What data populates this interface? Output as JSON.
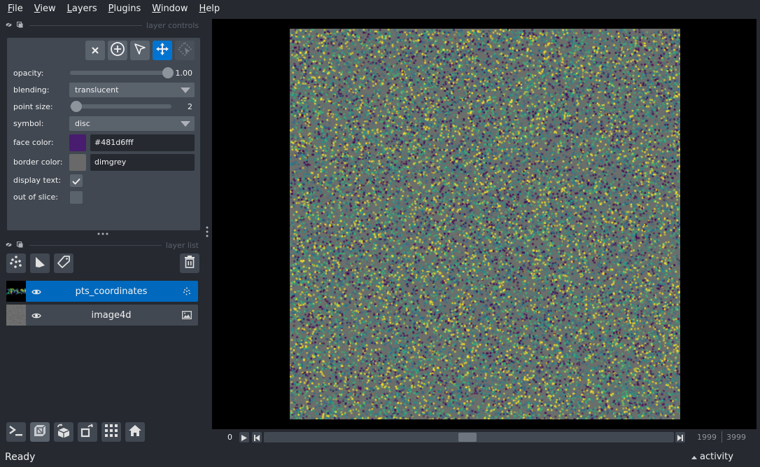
{
  "menu": [
    {
      "label": "File",
      "mnemonic": "F",
      "rest": "ile"
    },
    {
      "label": "View",
      "mnemonic": "V",
      "rest": "iew"
    },
    {
      "label": "Layers",
      "mnemonic": "L",
      "rest": "ayers"
    },
    {
      "label": "Plugins",
      "mnemonic": "P",
      "rest": "lugins"
    },
    {
      "label": "Window",
      "mnemonic": "W",
      "rest": "indow"
    },
    {
      "label": "Help",
      "mnemonic": "H",
      "rest": "elp"
    }
  ],
  "layer_controls": {
    "title": "layer controls",
    "tools": [
      {
        "name": "delete-selected-points",
        "icon": "close-icon",
        "state": "normal"
      },
      {
        "name": "add-points",
        "icon": "plus-circle-icon",
        "state": "normal"
      },
      {
        "name": "select-points",
        "icon": "pointer-icon",
        "state": "normal"
      },
      {
        "name": "pan-zoom",
        "icon": "move-arrows-icon",
        "state": "active"
      },
      {
        "name": "transform",
        "icon": "transform-icon",
        "state": "disabled"
      }
    ],
    "opacity": {
      "label": "opacity:",
      "value": 1.0,
      "display": "1.00"
    },
    "blending": {
      "label": "blending:",
      "value": "translucent"
    },
    "point_size": {
      "label": "point size:",
      "value": 2,
      "display": "2",
      "min": 1,
      "max": 100
    },
    "symbol": {
      "label": "symbol:",
      "value": "disc"
    },
    "face_color": {
      "label": "face color:",
      "value": "#481d6fff",
      "swatch": "#481d6f"
    },
    "border_color": {
      "label": "border color:",
      "value": "dimgrey",
      "swatch": "#696969"
    },
    "display_text": {
      "label": "display text:",
      "checked": true
    },
    "out_of_slice": {
      "label": "out of slice:",
      "checked": false
    }
  },
  "layer_list": {
    "title": "layer list",
    "buttons": [
      "new-points-layer",
      "new-shapes-layer",
      "new-labels-layer",
      "delete-layer"
    ],
    "layers": [
      {
        "name": "pts_coordinates",
        "visible": true,
        "selected": true,
        "type": "points"
      },
      {
        "name": "image4d",
        "visible": true,
        "selected": false,
        "type": "image"
      }
    ]
  },
  "bottom_buttons": [
    "console",
    "toggle-ndisplay",
    "roll-dimensions",
    "transpose-dimensions",
    "grid-view",
    "reset-view"
  ],
  "dims": {
    "axis_label": "0",
    "current": 1999,
    "current_display": "1999",
    "max_display": "3999",
    "fraction": 0.5
  },
  "status": {
    "text": "Ready",
    "activity": "activity"
  },
  "colors": {
    "accent": "#0074d0",
    "selected_layer": "#0069bd",
    "background": "#262930",
    "panel": "#414851",
    "viridis_points": [
      "#440154",
      "#31688e",
      "#35b779",
      "#fde725",
      "#21918c"
    ]
  }
}
